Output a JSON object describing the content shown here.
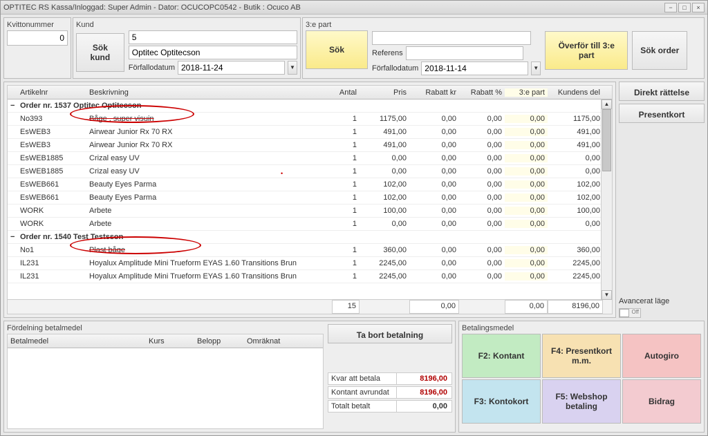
{
  "title": "OPTITEC RS Kassa/Inloggad: Super Admin - Dator: OCUCOPC0542 -  Butik : Ocuco AB",
  "kvitto_label": "Kvittonummer",
  "kvitto_value": "0",
  "kund": {
    "label": "Kund",
    "sok_btn": "Sök kund",
    "id": "5",
    "name": "Optitec Optitecson",
    "forfallo_label": "Förfallodatum",
    "forfallo_date": "2018-11-24"
  },
  "part3": {
    "label": "3:e part",
    "sok_btn": "Sök",
    "referens_label": "Referens",
    "referens_value": "",
    "forfallo_label": "Förfallodatum",
    "forfallo_date": "2018-11-14",
    "overfor_btn": "Överför till 3:e part",
    "sok_order_btn": "Sök order"
  },
  "grid": {
    "headers": {
      "artikelnr": "Artikelnr",
      "beskrivning": "Beskrivning",
      "antal": "Antal",
      "pris": "Pris",
      "rabattkr": "Rabatt kr",
      "rabattpc": "Rabatt %",
      "e3": "3:e part",
      "kundens": "Kundens del"
    },
    "groups": [
      {
        "title": "Order nr. 1537 Optitec Optitecson",
        "rows": [
          {
            "art": "No393",
            "desc": "Båge , super visuin",
            "strike": true,
            "antal": "1",
            "pris": "1175,00",
            "rk": "0,00",
            "rp": "0,00",
            "e3": "0,00",
            "kd": "1175,00"
          },
          {
            "art": "EsWEB3",
            "desc": "Airwear Junior Rx 70 RX",
            "antal": "1",
            "pris": "491,00",
            "rk": "0,00",
            "rp": "0,00",
            "e3": "0,00",
            "kd": "491,00"
          },
          {
            "art": "EsWEB3",
            "desc": "Airwear Junior Rx 70 RX",
            "antal": "1",
            "pris": "491,00",
            "rk": "0,00",
            "rp": "0,00",
            "e3": "0,00",
            "kd": "491,00"
          },
          {
            "art": "EsWEB1885",
            "desc": "Crizal easy UV",
            "antal": "1",
            "pris": "0,00",
            "rk": "0,00",
            "rp": "0,00",
            "e3": "0,00",
            "kd": "0,00"
          },
          {
            "art": "EsWEB1885",
            "desc": "Crizal easy UV",
            "antal": "1",
            "pris": "0,00",
            "rk": "0,00",
            "rp": "0,00",
            "e3": "0,00",
            "kd": "0,00"
          },
          {
            "art": "EsWEB661",
            "desc": "Beauty Eyes Parma",
            "antal": "1",
            "pris": "102,00",
            "rk": "0,00",
            "rp": "0,00",
            "e3": "0,00",
            "kd": "102,00"
          },
          {
            "art": "EsWEB661",
            "desc": "Beauty Eyes Parma",
            "antal": "1",
            "pris": "102,00",
            "rk": "0,00",
            "rp": "0,00",
            "e3": "0,00",
            "kd": "102,00"
          },
          {
            "art": "WORK",
            "desc": "Arbete",
            "antal": "1",
            "pris": "100,00",
            "rk": "0,00",
            "rp": "0,00",
            "e3": "0,00",
            "kd": "100,00"
          },
          {
            "art": "WORK",
            "desc": "Arbete",
            "antal": "1",
            "pris": "0,00",
            "rk": "0,00",
            "rp": "0,00",
            "e3": "0,00",
            "kd": "0,00"
          }
        ]
      },
      {
        "title": "Order nr. 1540 Test Testsson",
        "rows": [
          {
            "art": "No1",
            "desc": "Plast båge",
            "strike": true,
            "antal": "1",
            "pris": "360,00",
            "rk": "0,00",
            "rp": "0,00",
            "e3": "0,00",
            "kd": "360,00"
          },
          {
            "art": "IL231",
            "desc": "Hoyalux Amplitude Mini Trueform EYAS 1.60 Transitions Brun",
            "antal": "1",
            "pris": "2245,00",
            "rk": "0,00",
            "rp": "0,00",
            "e3": "0,00",
            "kd": "2245,00"
          },
          {
            "art": "IL231",
            "desc": "Hoyalux Amplitude Mini Trueform EYAS 1.60 Transitions Brun",
            "antal": "1",
            "pris": "2245,00",
            "rk": "0,00",
            "rp": "0,00",
            "e3": "0,00",
            "kd": "2245,00"
          }
        ]
      }
    ],
    "totals": {
      "antal": "15",
      "pris": "",
      "rk": "0,00",
      "rp": "",
      "e3": "0,00",
      "kd": "8196,00"
    }
  },
  "side": {
    "direkt": "Direkt rättelse",
    "present": "Presentkort",
    "adv_label": "Avancerat läge",
    "off": "Off"
  },
  "fordelning": {
    "label": "Fördelning betalmedel",
    "headers": {
      "betalmedel": "Betalmedel",
      "kurs": "Kurs",
      "belopp": "Belopp",
      "omraknat": "Omräknat"
    },
    "ta_bort": "Ta bort betalning",
    "kvar_label": "Kvar att betala",
    "kvar_val": "8196,00",
    "avr_label": "Kontant avrundat",
    "avr_val": "8196,00",
    "tot_label": "Totalt betalt",
    "tot_val": "0,00"
  },
  "payments": {
    "label": "Betalingsmedel",
    "cells": [
      {
        "t": "F2: Kontant",
        "c": "c-green"
      },
      {
        "t": "F4: Presentkort m.m.",
        "c": "c-orange"
      },
      {
        "t": "Autogiro",
        "c": "c-red"
      },
      {
        "t": "F3: Kontokort",
        "c": "c-blue"
      },
      {
        "t": "F5: Webshop betaling",
        "c": "c-purple"
      },
      {
        "t": "Bidrag",
        "c": "c-pink"
      }
    ]
  }
}
